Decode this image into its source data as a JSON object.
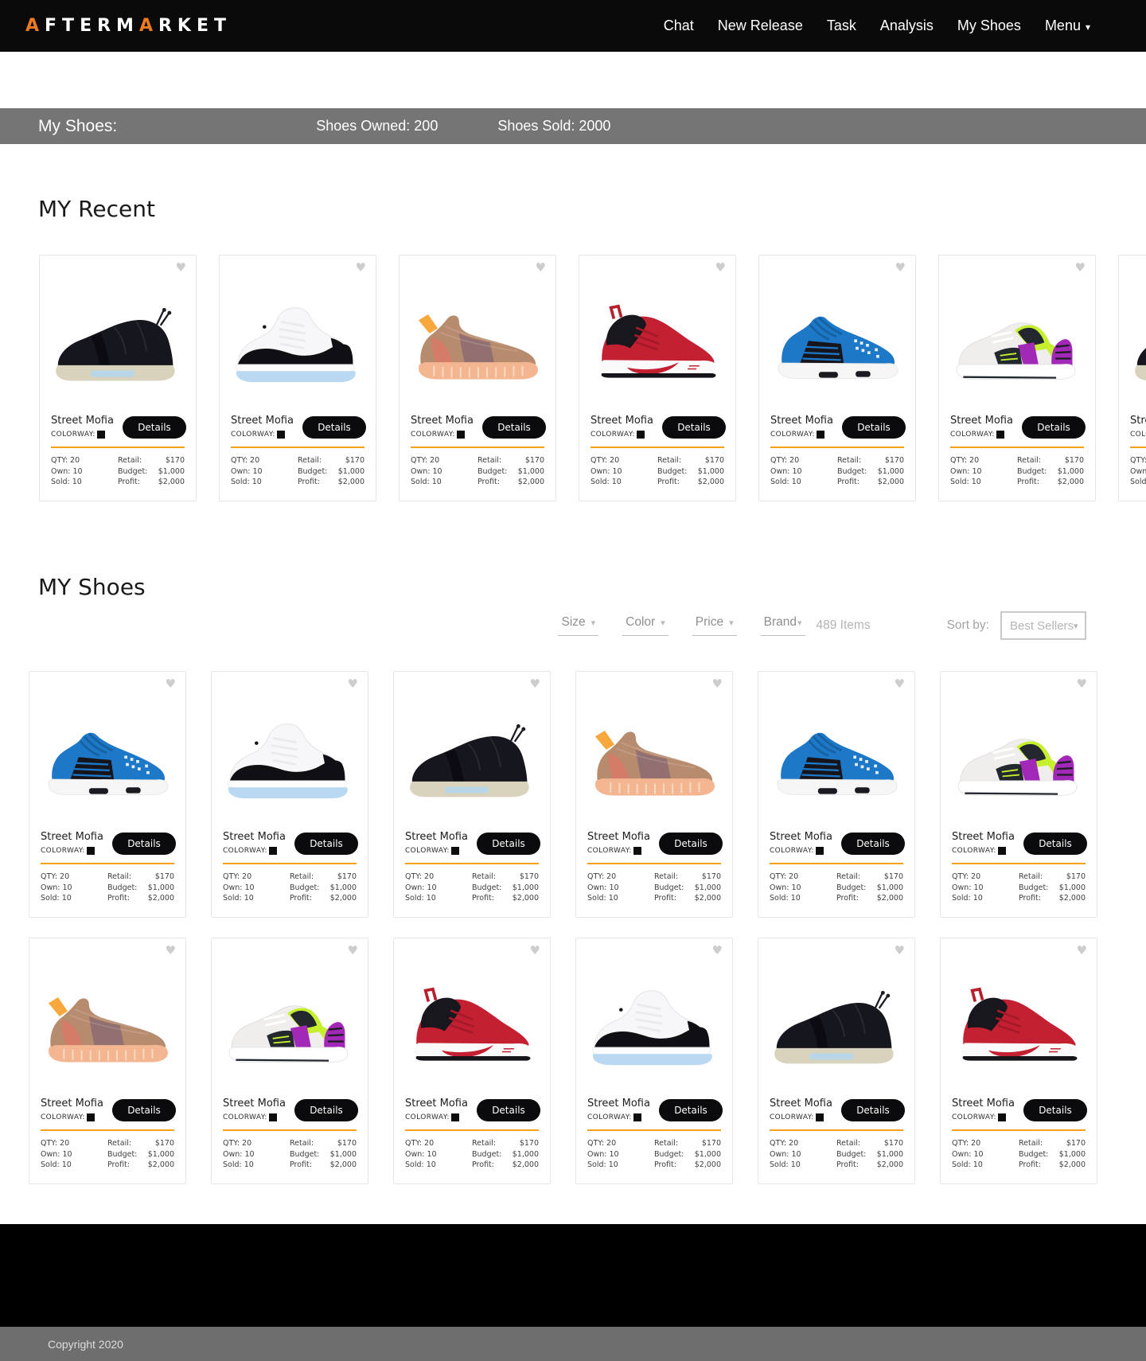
{
  "header": {
    "logo_parts": [
      "A",
      "FTERM",
      "A",
      "RKET"
    ],
    "nav": [
      {
        "label": "Chat"
      },
      {
        "label": "New Release"
      },
      {
        "label": "Task"
      },
      {
        "label": "Analysis"
      },
      {
        "label": "My Shoes"
      },
      {
        "label": "Menu",
        "caret": "▾"
      }
    ]
  },
  "status_bar": {
    "title": "My Shoes:",
    "owned": "Shoes Owned: 200",
    "sold": "Shoes Sold: 2000"
  },
  "sections": {
    "recent_title": "MY Recent",
    "shoes_title": "MY Shoes"
  },
  "filters": {
    "items": [
      "Size",
      "Color",
      "Price",
      "Brand"
    ],
    "caret": "▾",
    "items_count": "489 Items",
    "sort_label": "Sort by:",
    "sort_value": "Best Sellers"
  },
  "card": {
    "name": "Street Mofia",
    "colorway_label": "COLORWAY:",
    "details_label": "Details",
    "heart": "♥",
    "stats_left": [
      {
        "label": "QTY:",
        "value": "20"
      },
      {
        "label": "Own:",
        "value": "10"
      },
      {
        "label": "Sold:",
        "value": "10"
      }
    ],
    "stats_right": [
      {
        "label": "Retail:",
        "value": "$170"
      },
      {
        "label": "Budget:",
        "value": "$1,000"
      },
      {
        "label": "Profit:",
        "value": "$2,000"
      }
    ]
  },
  "recent_cards": [
    {
      "shoe": "fog-moccasin-black"
    },
    {
      "shoe": "jordan-11-concord"
    },
    {
      "shoe": "yeezy-350-clay"
    },
    {
      "shoe": "pg3-red"
    },
    {
      "shoe": "nmd-hu-blue"
    },
    {
      "shoe": "huarache-purple-volt"
    },
    {
      "shoe": "fog-moccasin-black"
    }
  ],
  "grid_cards": [
    {
      "shoe": "nmd-hu-blue"
    },
    {
      "shoe": "jordan-11-concord"
    },
    {
      "shoe": "fog-moccasin-black"
    },
    {
      "shoe": "yeezy-350-clay"
    },
    {
      "shoe": "nmd-hu-blue"
    },
    {
      "shoe": "huarache-purple-volt"
    },
    {
      "shoe": "yeezy-350-clay"
    },
    {
      "shoe": "huarache-purple-volt"
    },
    {
      "shoe": "pg3-red"
    },
    {
      "shoe": "jordan-11-concord"
    },
    {
      "shoe": "fog-moccasin-black"
    },
    {
      "shoe": "pg3-red"
    }
  ],
  "footer": {
    "copyright": "Copyright 2020"
  },
  "colors": {
    "accent_orange": "#ED7B20",
    "divider_orange": "#F5A11C",
    "header_black": "#0a0a0a",
    "status_bar_gray": "#757575",
    "footer_gray": "#6e6e6e",
    "details_button_black": "#0b0b0d"
  }
}
